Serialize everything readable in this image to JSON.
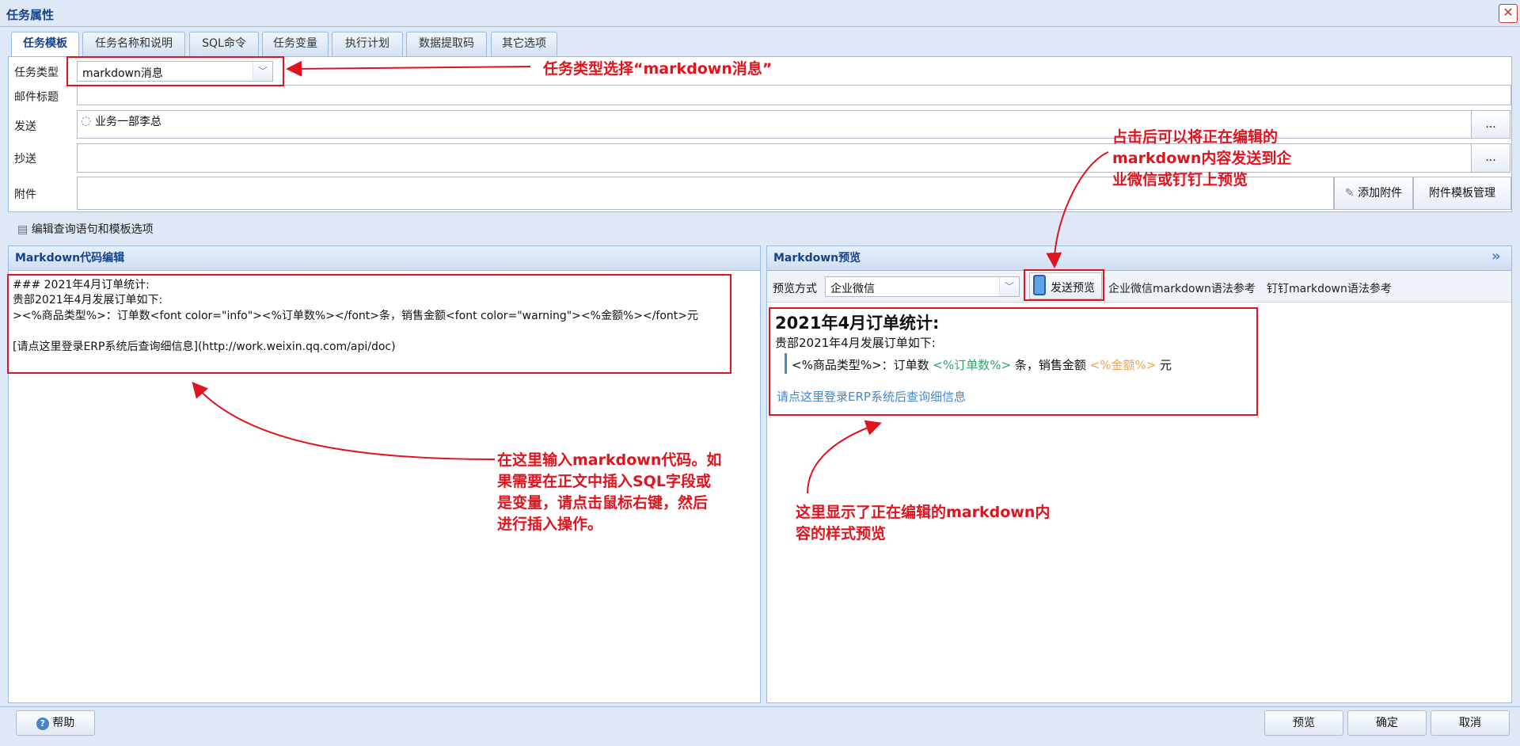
{
  "window": {
    "title": "任务属性"
  },
  "tabs": [
    {
      "label": "任务模板",
      "active": true
    },
    {
      "label": "任务名称和说明"
    },
    {
      "label": "SQL命令"
    },
    {
      "label": "任务变量"
    },
    {
      "label": "执行计划"
    },
    {
      "label": "数据提取码"
    },
    {
      "label": "其它选项"
    }
  ],
  "form": {
    "task_type_label": "任务类型",
    "task_type_value": "markdown消息",
    "mail_subject_label": "邮件标题",
    "mail_subject_value": "",
    "to_label": "发送",
    "to_value": "业务一部李总",
    "cc_label": "抄送",
    "cc_value": "",
    "attach_label": "附件",
    "add_attachment": "添加附件",
    "attachment_template": "附件模板管理",
    "browse": "..."
  },
  "toolbar": {
    "edit_query": "编辑查询语句和模板选项"
  },
  "editor": {
    "title": "Markdown代码编辑",
    "lines": [
      "### 2021年4月订单统计:",
      "贵部2021年4月发展订单如下:",
      "><%商品类型%>：订单数<font color=\"info\"><%订单数%></font>条，销售金额<font color=\"warning\"><%金额%></font>元",
      "[请点这里登录ERP系统后查询细信息](http://work.weixin.qq.com/api/doc)"
    ]
  },
  "preview": {
    "title": "Markdown预览",
    "collapse": "»",
    "mode_label": "预览方式",
    "mode_value": "企业微信",
    "send_preview": "发送预览",
    "wecom_ref": "企业微信markdown语法参考",
    "dingtalk_ref": "钉钉markdown语法参考",
    "heading": "2021年4月订单统计:",
    "line1": "贵部2021年4月发展订单如下:",
    "quote_a": "<%商品类型%>：订单数 ",
    "quote_info": "<%订单数%>",
    "quote_b": " 条，销售金额 ",
    "quote_warn": "<%金额%>",
    "quote_c": " 元",
    "link": "请点这里登录ERP系统后查询细信息",
    "colors": {
      "info": "#2fa36b",
      "warning": "#f0a44b",
      "link": "#4a84c8"
    }
  },
  "footer": {
    "help": "帮助",
    "preview": "预览",
    "ok": "确定",
    "cancel": "取消"
  },
  "annotations": {
    "a1": "任务类型选择“markdown消息”",
    "a2_lines": [
      "占击后可以将正在编辑的",
      "markdown内容发送到企",
      "业微信或钉钉上预览"
    ],
    "a3_lines": [
      "在这里输入markdown代码。如",
      "果需要在正文中插入SQL字段或",
      "是变量，请点击鼠标右键，然后",
      "进行插入操作。"
    ],
    "a4_lines": [
      "这里显示了正在编辑的markdown内",
      "容的样式预览"
    ]
  }
}
